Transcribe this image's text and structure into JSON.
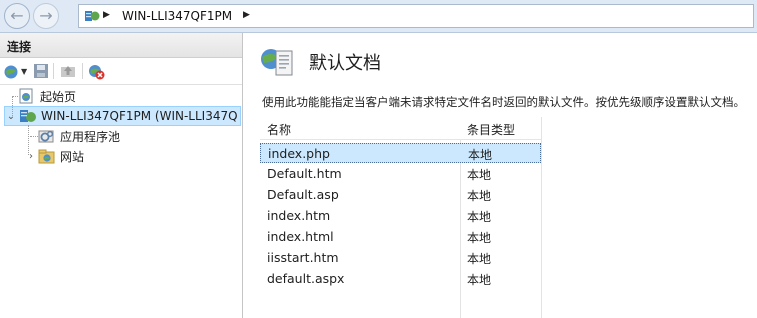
{
  "address_bar": {
    "path": "WIN-LLI347QF1PM"
  },
  "connections": {
    "title": "连接",
    "tree": [
      {
        "label": "起始页"
      },
      {
        "label": "WIN-LLI347QF1PM (WIN-LLI347Q"
      },
      {
        "label": "应用程序池"
      },
      {
        "label": "网站"
      }
    ]
  },
  "main": {
    "title": "默认文档",
    "description": "使用此功能能指定当客户端未请求特定文件名时返回的默认文件。按优先级顺序设置默认文档。",
    "columns": {
      "name": "名称",
      "type": "条目类型"
    },
    "rows": [
      {
        "name": "index.php",
        "type": "本地"
      },
      {
        "name": "Default.htm",
        "type": "本地"
      },
      {
        "name": "Default.asp",
        "type": "本地"
      },
      {
        "name": "index.htm",
        "type": "本地"
      },
      {
        "name": "index.html",
        "type": "本地"
      },
      {
        "name": "iisstart.htm",
        "type": "本地"
      },
      {
        "name": "default.aspx",
        "type": "本地"
      }
    ],
    "selected_row": 0
  },
  "colors": {
    "selection": "#cce8ff",
    "address_bar_bg": "#dfe9f5"
  }
}
